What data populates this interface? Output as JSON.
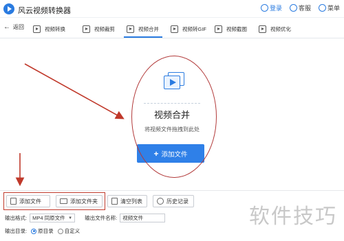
{
  "app": {
    "title": "风云视频转换器"
  },
  "titlebar": {
    "login": "登录",
    "service": "客服",
    "menu": "菜单"
  },
  "toolbar": {
    "back": "返回",
    "tabs": [
      {
        "label": "视频转换"
      },
      {
        "label": "视频裁剪"
      },
      {
        "label": "视频合并"
      },
      {
        "label": "视频转GIF"
      },
      {
        "label": "视频截图"
      },
      {
        "label": "视频优化"
      }
    ],
    "active_tab": "视频合并"
  },
  "main": {
    "title": "视频合并",
    "hint": "将视频文件拖拽到此处",
    "add_button": "添加文件"
  },
  "bottom": {
    "add_file": "添加文件",
    "add_folder": "添加文件夹",
    "clear_list": "清空列表",
    "history": "历史记录",
    "format_label": "输出格式:",
    "format_value": "MP4 同原文件",
    "name_label": "输出文件名称:",
    "name_value": "视频文件",
    "dir_label": "输出目录:",
    "dir_options": [
      "原目录",
      "自定义"
    ],
    "dir_selected": "原目录"
  },
  "watermark": "软件技巧",
  "colors": {
    "accent": "#2a7be0",
    "button": "#2f80e8",
    "annotation": "#c0392b"
  }
}
